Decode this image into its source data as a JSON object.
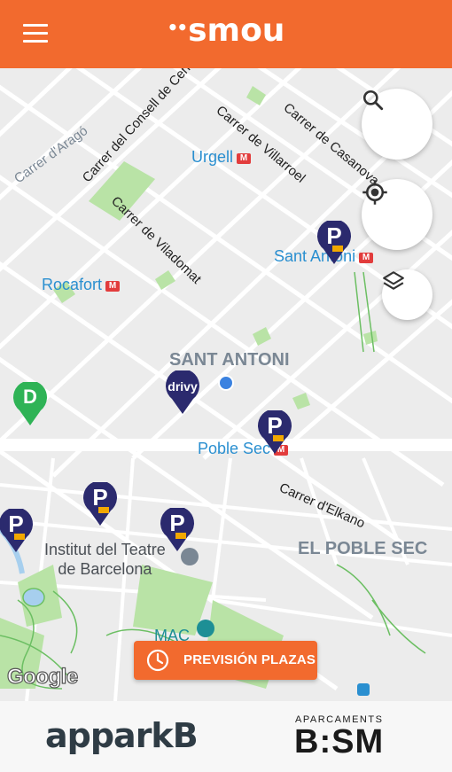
{
  "header": {
    "brand": "smou",
    "brand_dots": "••",
    "menu_icon": "hamburger-menu-icon",
    "color": "#f26a2e"
  },
  "map": {
    "streets": [
      {
        "name": "Carrer del Consell de Cent"
      },
      {
        "name": "Carrer de Villarroel"
      },
      {
        "name": "Carrer de Casanova"
      },
      {
        "name": "Carrer d'Aragó"
      },
      {
        "name": "Carrer de Viladomat"
      },
      {
        "name": "Carrer d'Elkano"
      }
    ],
    "metro_stations": [
      {
        "name": "Urgell"
      },
      {
        "name": "Sant Antoni"
      },
      {
        "name": "Rocafort"
      },
      {
        "name": "Poble Sec"
      }
    ],
    "metro_icon_label": "M",
    "districts": [
      {
        "name": "SANT ANTONI"
      },
      {
        "name": "EL POBLE SEC"
      }
    ],
    "pois": [
      {
        "name": "Institut del Teatre\nde Barcelona"
      },
      {
        "name": "MAC"
      }
    ],
    "pins": {
      "parking_label": "P",
      "drivy_label": "drivy",
      "charging_label": "D"
    },
    "attribution": "Google"
  },
  "controls": {
    "search_icon": "search-icon",
    "locate_icon": "locate-icon",
    "layers_icon": "layers-icon"
  },
  "forecast_button": {
    "label": "PREVISIÓN PLAZAS",
    "icon": "clock-icon"
  },
  "footer": {
    "appark_text": "appark",
    "appark_b": "B",
    "bsm_small": "APARCAMENTS",
    "bsm_big": "B:SM"
  }
}
